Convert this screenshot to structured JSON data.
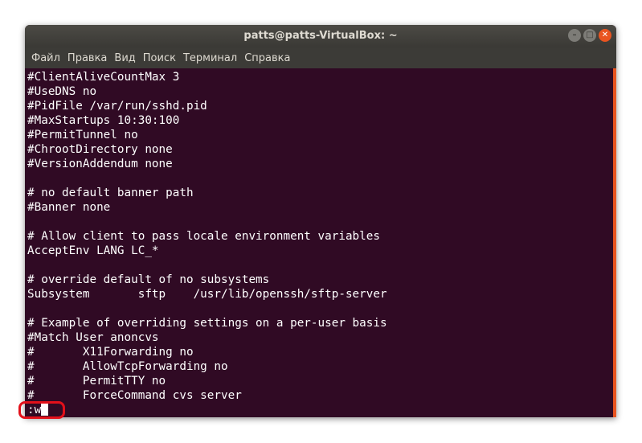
{
  "window": {
    "title": "patts@patts-VirtualBox: ~",
    "controls": {
      "minimize_icon": "minimize-icon",
      "maximize_icon": "maximize-icon",
      "close_icon": "close-icon"
    }
  },
  "menu": {
    "items": [
      "Файл",
      "Правка",
      "Вид",
      "Поиск",
      "Терминал",
      "Справка"
    ]
  },
  "terminal": {
    "lines": [
      "#ClientAliveCountMax 3",
      "#UseDNS no",
      "#PidFile /var/run/sshd.pid",
      "#MaxStartups 10:30:100",
      "#PermitTunnel no",
      "#ChrootDirectory none",
      "#VersionAddendum none",
      "",
      "# no default banner path",
      "#Banner none",
      "",
      "# Allow client to pass locale environment variables",
      "AcceptEnv LANG LC_*",
      "",
      "# override default of no subsystems",
      "Subsystem       sftp    /usr/lib/openssh/sftp-server",
      "",
      "# Example of overriding settings on a per-user basis",
      "#Match User anoncvs",
      "#       X11Forwarding no",
      "#       AllowTcpForwarding no",
      "#       PermitTTY no",
      "#       ForceCommand cvs server"
    ],
    "command": ":w"
  },
  "colors": {
    "terminal_bg": "#300a24",
    "scrollbar": "#e95420",
    "highlight": "#e3101a"
  }
}
